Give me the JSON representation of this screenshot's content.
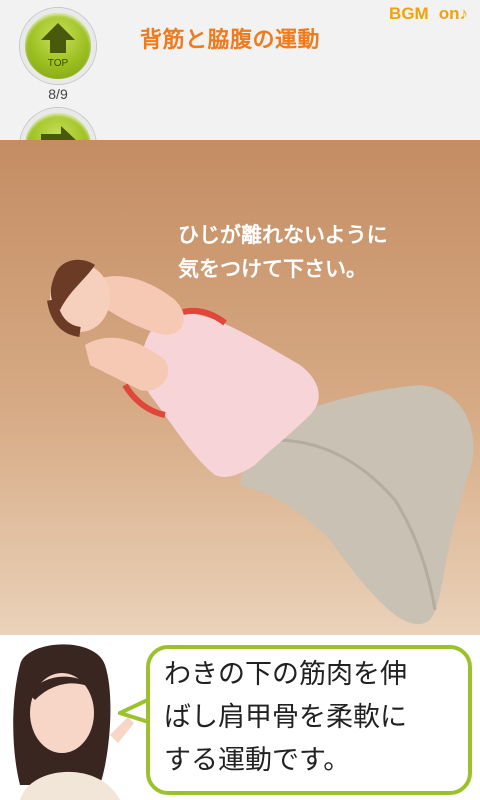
{
  "header": {
    "title": "背筋と脇腹の運動",
    "bgm_label": "BGM",
    "bgm_state": "on♪",
    "top_button_label": "TOP",
    "next_button_label": "次へ",
    "counter": "8/9"
  },
  "stage": {
    "instruction": "ひじが離れないように\n気をつけて下さい。"
  },
  "bubble": {
    "text": "わきの下の筋肉を伸\nばし肩甲骨を柔軟に\nする運動です。"
  },
  "colors": {
    "accent_orange": "#ef7b1c",
    "button_green": "#9bbf1f",
    "bubble_border": "#9cc22b",
    "floor": "#c48d63"
  },
  "icons": [
    "up-arrow-icon",
    "right-arrow-icon"
  ]
}
